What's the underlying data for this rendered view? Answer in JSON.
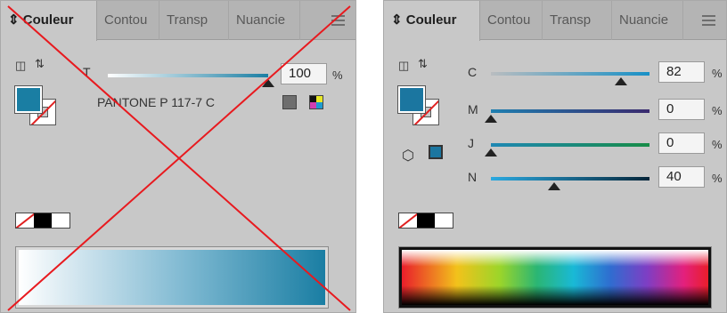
{
  "tabs": {
    "couleur": "Couleur",
    "contour": "Contou",
    "transparence": "Transp",
    "nuancier": "Nuancie"
  },
  "left_panel": {
    "tint_label": "T",
    "tint_value": "100",
    "percent": "%",
    "pantone_name": "PANTONE P 117-7 C",
    "tint_fraction": 1.0,
    "crossed_out": true,
    "colors": {
      "pantone": "#1a7ea3",
      "cross": "#e8191e"
    }
  },
  "right_panel": {
    "channels": [
      {
        "label": "C",
        "value": "82",
        "percent": "%",
        "fraction": 0.82
      },
      {
        "label": "M",
        "value": "0",
        "percent": "%",
        "fraction": 0.0
      },
      {
        "label": "J",
        "value": "0",
        "percent": "%",
        "fraction": 0.0
      },
      {
        "label": "N",
        "value": "40",
        "percent": "%",
        "fraction": 0.4
      }
    ],
    "colors": {
      "fill": "#1b76a0"
    }
  },
  "icons": {
    "swap": "swap-arrows-icon",
    "default": "default-colors-icon",
    "menu": "panel-menu-icon",
    "gamut_cube": "3d-cube-icon",
    "out_of_gamut_swatch": "web-safe-swatch-icon"
  }
}
